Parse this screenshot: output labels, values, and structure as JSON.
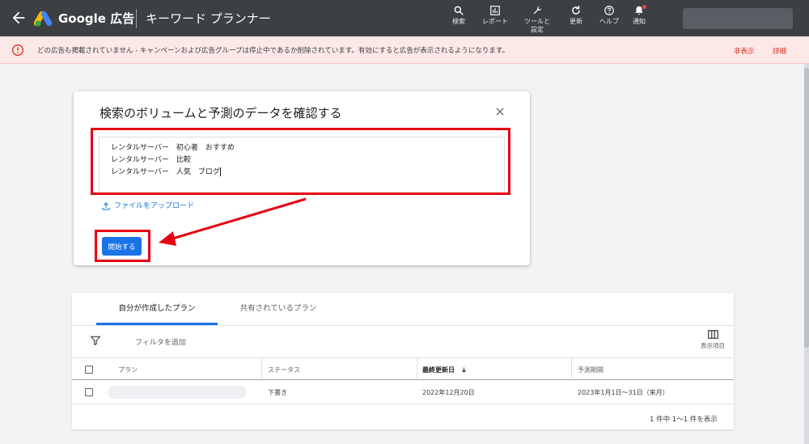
{
  "header": {
    "brand": "Google 広告",
    "app_title": "キーワード プランナー",
    "tools": [
      {
        "label": "検索",
        "icon": "search-icon"
      },
      {
        "label": "レポート",
        "icon": "report-icon"
      },
      {
        "label": "ツールと\n設定",
        "icon": "wrench-icon"
      },
      {
        "label": "更新",
        "icon": "refresh-icon"
      },
      {
        "label": "ヘルプ",
        "icon": "help-icon"
      },
      {
        "label": "通知",
        "icon": "bell-icon"
      }
    ]
  },
  "banner": {
    "message": "どの広告も掲載されていません - キャンペーンおよび広告グループは停止中であるか削除されています。有効にすると広告が表示されるようになります。",
    "hide_label": "非表示",
    "detail_label": "詳細"
  },
  "dialog": {
    "title": "検索のボリュームと予測のデータを確認する",
    "keywords": [
      "レンタルサーバー　初心者　おすすめ",
      "レンタルサーバー　比較",
      "レンタルサーバー　人気　ブログ"
    ],
    "upload_label": "ファイルをアップロード",
    "start_label": "開始する"
  },
  "plans": {
    "tabs": [
      "自分が作成したプラン",
      "共有されているプラン"
    ],
    "filter_label": "フィルタを追加",
    "columns_label": "表示項目",
    "headers": [
      "プラン",
      "ステータス",
      "最終更新日",
      "予測期間"
    ],
    "rows": [
      {
        "status": "下書き",
        "updated": "2022年12月20日",
        "period": "2023年1月1日～31日（来月）"
      }
    ],
    "pagination": "1 件中 1～1 件を表示"
  },
  "colors": {
    "topbar": "#3c4043",
    "accent": "#1a73e8",
    "annotation": "#e60012",
    "banner_bg": "#fce8e6"
  }
}
